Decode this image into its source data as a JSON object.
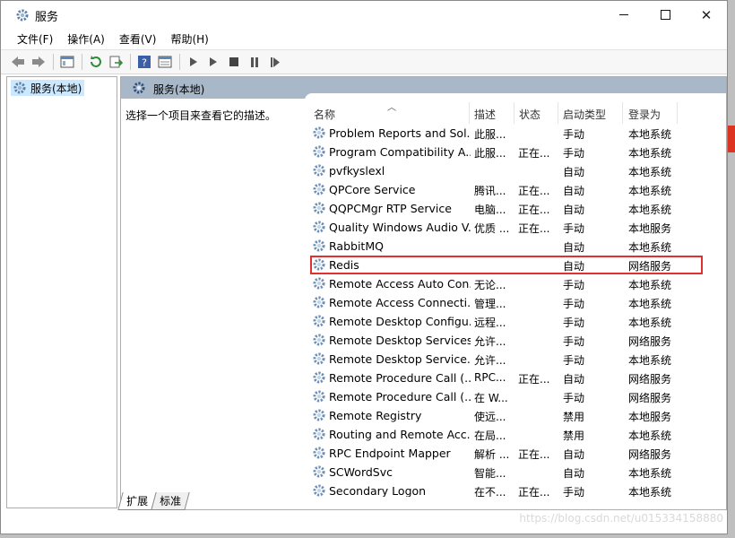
{
  "window": {
    "title": "服务"
  },
  "menu": [
    "文件(F)",
    "操作(A)",
    "查看(V)",
    "帮助(H)"
  ],
  "toolbar_icons": [
    "back-icon",
    "forward-icon",
    "console-tree-icon",
    "refresh-icon",
    "export-list-icon",
    "help-icon",
    "properties-icon",
    "start-service-icon",
    "start-service-alt-icon",
    "stop-service-icon",
    "pause-service-icon",
    "restart-service-icon"
  ],
  "tree": {
    "node_label": "服务(本地)"
  },
  "pane": {
    "title": "服务(本地)",
    "description": "选择一个项目来查看它的描述。"
  },
  "columns": {
    "name": "名称",
    "desc": "描述",
    "status": "状态",
    "start": "启动类型",
    "logon": "登录为"
  },
  "rows": [
    {
      "name": "Problem Reports and Sol...",
      "desc": "此服...",
      "status": "",
      "start": "手动",
      "logon": "本地系统"
    },
    {
      "name": "Program Compatibility A...",
      "desc": "此服...",
      "status": "正在...",
      "start": "手动",
      "logon": "本地系统"
    },
    {
      "name": "pvfkyslexl",
      "desc": "",
      "status": "",
      "start": "自动",
      "logon": "本地系统"
    },
    {
      "name": "QPCore Service",
      "desc": "腾讯...",
      "status": "正在...",
      "start": "自动",
      "logon": "本地系统"
    },
    {
      "name": "QQPCMgr RTP Service",
      "desc": "电脑...",
      "status": "正在...",
      "start": "自动",
      "logon": "本地系统"
    },
    {
      "name": "Quality Windows Audio V...",
      "desc": "优质 ...",
      "status": "正在...",
      "start": "手动",
      "logon": "本地服务"
    },
    {
      "name": "RabbitMQ",
      "desc": "",
      "status": "",
      "start": "自动",
      "logon": "本地系统"
    },
    {
      "name": "Redis",
      "desc": "",
      "status": "",
      "start": "自动",
      "logon": "网络服务"
    },
    {
      "name": "Remote Access Auto Con...",
      "desc": "无论...",
      "status": "",
      "start": "手动",
      "logon": "本地系统"
    },
    {
      "name": "Remote Access Connecti...",
      "desc": "管理...",
      "status": "",
      "start": "手动",
      "logon": "本地系统"
    },
    {
      "name": "Remote Desktop Configu...",
      "desc": "远程...",
      "status": "",
      "start": "手动",
      "logon": "本地系统"
    },
    {
      "name": "Remote Desktop Services",
      "desc": "允许...",
      "status": "",
      "start": "手动",
      "logon": "网络服务"
    },
    {
      "name": "Remote Desktop Service...",
      "desc": "允许...",
      "status": "",
      "start": "手动",
      "logon": "本地系统"
    },
    {
      "name": "Remote Procedure Call (...",
      "desc": "RPC...",
      "status": "正在...",
      "start": "自动",
      "logon": "网络服务"
    },
    {
      "name": "Remote Procedure Call (...",
      "desc": "在 W...",
      "status": "",
      "start": "手动",
      "logon": "网络服务"
    },
    {
      "name": "Remote Registry",
      "desc": "使远...",
      "status": "",
      "start": "禁用",
      "logon": "本地服务"
    },
    {
      "name": "Routing and Remote Acc...",
      "desc": "在局...",
      "status": "",
      "start": "禁用",
      "logon": "本地系统"
    },
    {
      "name": "RPC Endpoint Mapper",
      "desc": "解析 ...",
      "status": "正在...",
      "start": "自动",
      "logon": "网络服务"
    },
    {
      "name": "SCWordSvc",
      "desc": "智能...",
      "status": "",
      "start": "自动",
      "logon": "本地系统"
    },
    {
      "name": "Secondary Logon",
      "desc": "在不...",
      "status": "正在...",
      "start": "手动",
      "logon": "本地系统"
    }
  ],
  "selected_row_index": 7,
  "tabs": [
    "扩展",
    "标准"
  ],
  "watermark": "https://blog.csdn.net/u015334158880",
  "colors": {
    "header": "#a8b8c8",
    "selection": "#cce8ff",
    "highlight_border": "#e03030"
  }
}
